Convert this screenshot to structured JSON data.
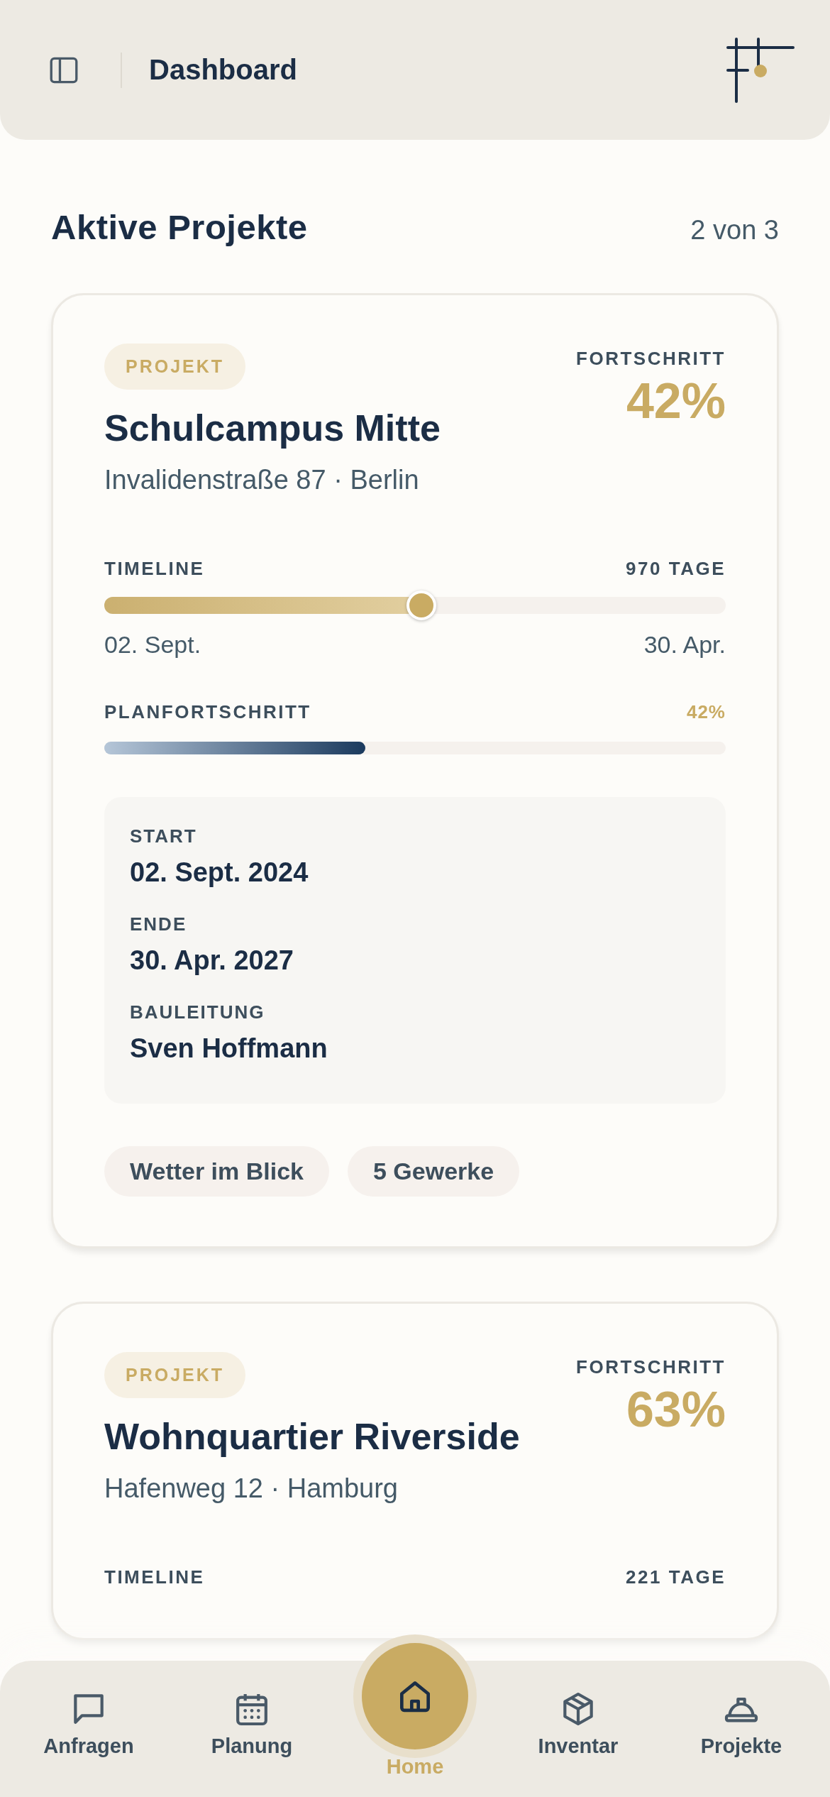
{
  "header": {
    "title": "Dashboard"
  },
  "section": {
    "title": "Aktive Projekte",
    "count": "2 von 3"
  },
  "projects": [
    {
      "badge": "PROJEKT",
      "name": "Schulcampus Mitte",
      "address": "Invalidenstraße 87 · Berlin",
      "progress_label": "FORTSCHRITT",
      "progress": "42%",
      "timeline": {
        "label": "TIMELINE",
        "days": "970 TAGE",
        "level": 0.51,
        "start": "02. Sept.",
        "end": "30. Apr."
      },
      "plan": {
        "label": "PLANFORTSCHRITT",
        "value": "42%",
        "level": 0.42
      },
      "details": [
        {
          "label": "START",
          "value": "02. Sept. 2024"
        },
        {
          "label": "ENDE",
          "value": "30. Apr. 2027"
        },
        {
          "label": "BAULEITUNG",
          "value": "Sven Hoffmann"
        }
      ],
      "chips": [
        "Wetter im Blick",
        "5 Gewerke"
      ]
    },
    {
      "badge": "PROJEKT",
      "name": "Wohnquartier Riverside",
      "address": "Hafenweg 12 · Hamburg",
      "progress_label": "FORTSCHRITT",
      "progress": "63%",
      "timeline": {
        "label": "TIMELINE",
        "days": "221 TAGE"
      }
    }
  ],
  "nav": [
    {
      "kind": "chat",
      "label": "Anfragen",
      "selected": false
    },
    {
      "kind": "calendar",
      "label": "Planung",
      "selected": false
    },
    {
      "kind": "home",
      "label": "Home",
      "selected": true
    },
    {
      "kind": "box",
      "label": "Inventar",
      "selected": false
    },
    {
      "kind": "helmet",
      "label": "Projekte",
      "selected": false
    }
  ]
}
